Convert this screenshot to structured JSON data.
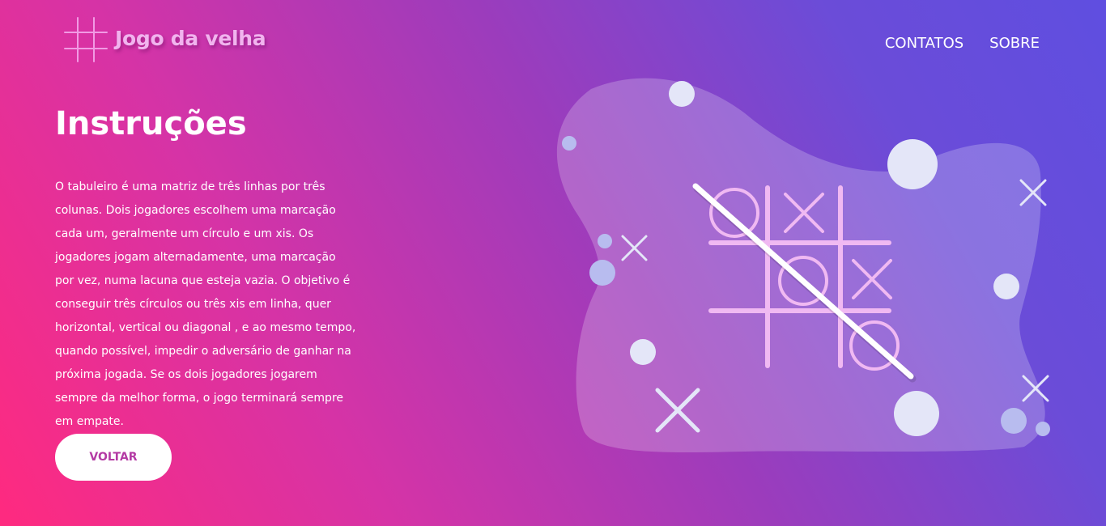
{
  "header": {
    "logo_text": "Jogo da velha",
    "nav": {
      "contacts_label": "CONTATOS",
      "about_label": "SOBRE"
    }
  },
  "main": {
    "title": "Instruções",
    "description": "O tabuleiro é uma matriz de três linhas por três colunas. Dois jogadores escolhem uma marcação cada um, geralmente um círculo e um xis. Os jogadores jogam alternadamente, uma marcação por vez, numa lacuna que esteja vazia. O objetivo é conseguir três círculos ou três xis em linha, quer horizontal, vertical ou diagonal , e ao mesmo tempo, quando possível, impedir o adversário de ganhar na próxima jogada. Se os dois jogadores jogarem sempre da melhor forma, o jogo terminará sempre em empate.",
    "back_button_label": "VOLTAR"
  },
  "colors": {
    "gradient_start": "#ff2a7f",
    "gradient_end": "#5f4ee0",
    "logo_text": "#f1b4ee",
    "button_text": "#b43aa4"
  },
  "icons": {
    "logo": "hash-grid-icon",
    "illustration": "tic-tac-toe-board-illustration"
  }
}
